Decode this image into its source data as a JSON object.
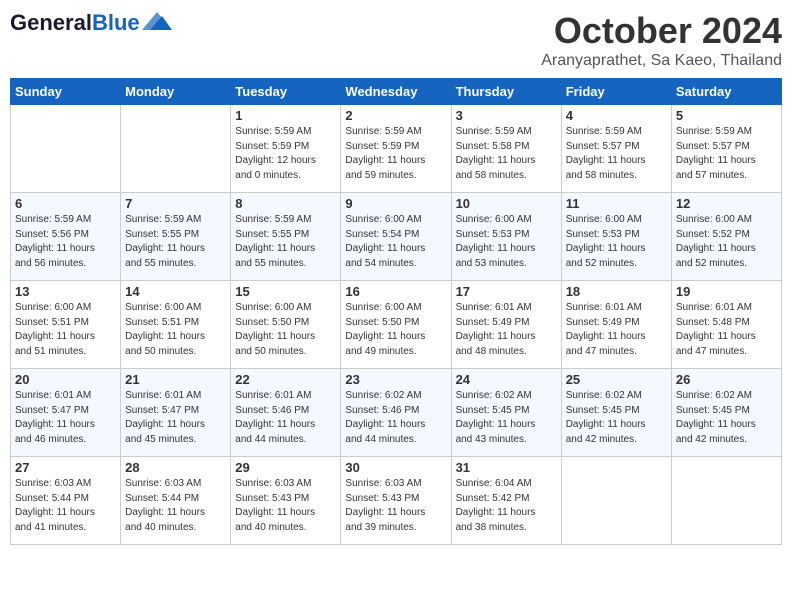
{
  "header": {
    "logo_general": "General",
    "logo_blue": "Blue",
    "month_title": "October 2024",
    "location": "Aranyaprathet, Sa Kaeo, Thailand"
  },
  "days_of_week": [
    "Sunday",
    "Monday",
    "Tuesday",
    "Wednesday",
    "Thursday",
    "Friday",
    "Saturday"
  ],
  "weeks": [
    [
      {
        "day": "",
        "info": ""
      },
      {
        "day": "",
        "info": ""
      },
      {
        "day": "1",
        "info": "Sunrise: 5:59 AM\nSunset: 5:59 PM\nDaylight: 12 hours\nand 0 minutes."
      },
      {
        "day": "2",
        "info": "Sunrise: 5:59 AM\nSunset: 5:59 PM\nDaylight: 11 hours\nand 59 minutes."
      },
      {
        "day": "3",
        "info": "Sunrise: 5:59 AM\nSunset: 5:58 PM\nDaylight: 11 hours\nand 58 minutes."
      },
      {
        "day": "4",
        "info": "Sunrise: 5:59 AM\nSunset: 5:57 PM\nDaylight: 11 hours\nand 58 minutes."
      },
      {
        "day": "5",
        "info": "Sunrise: 5:59 AM\nSunset: 5:57 PM\nDaylight: 11 hours\nand 57 minutes."
      }
    ],
    [
      {
        "day": "6",
        "info": "Sunrise: 5:59 AM\nSunset: 5:56 PM\nDaylight: 11 hours\nand 56 minutes."
      },
      {
        "day": "7",
        "info": "Sunrise: 5:59 AM\nSunset: 5:55 PM\nDaylight: 11 hours\nand 55 minutes."
      },
      {
        "day": "8",
        "info": "Sunrise: 5:59 AM\nSunset: 5:55 PM\nDaylight: 11 hours\nand 55 minutes."
      },
      {
        "day": "9",
        "info": "Sunrise: 6:00 AM\nSunset: 5:54 PM\nDaylight: 11 hours\nand 54 minutes."
      },
      {
        "day": "10",
        "info": "Sunrise: 6:00 AM\nSunset: 5:53 PM\nDaylight: 11 hours\nand 53 minutes."
      },
      {
        "day": "11",
        "info": "Sunrise: 6:00 AM\nSunset: 5:53 PM\nDaylight: 11 hours\nand 52 minutes."
      },
      {
        "day": "12",
        "info": "Sunrise: 6:00 AM\nSunset: 5:52 PM\nDaylight: 11 hours\nand 52 minutes."
      }
    ],
    [
      {
        "day": "13",
        "info": "Sunrise: 6:00 AM\nSunset: 5:51 PM\nDaylight: 11 hours\nand 51 minutes."
      },
      {
        "day": "14",
        "info": "Sunrise: 6:00 AM\nSunset: 5:51 PM\nDaylight: 11 hours\nand 50 minutes."
      },
      {
        "day": "15",
        "info": "Sunrise: 6:00 AM\nSunset: 5:50 PM\nDaylight: 11 hours\nand 50 minutes."
      },
      {
        "day": "16",
        "info": "Sunrise: 6:00 AM\nSunset: 5:50 PM\nDaylight: 11 hours\nand 49 minutes."
      },
      {
        "day": "17",
        "info": "Sunrise: 6:01 AM\nSunset: 5:49 PM\nDaylight: 11 hours\nand 48 minutes."
      },
      {
        "day": "18",
        "info": "Sunrise: 6:01 AM\nSunset: 5:49 PM\nDaylight: 11 hours\nand 47 minutes."
      },
      {
        "day": "19",
        "info": "Sunrise: 6:01 AM\nSunset: 5:48 PM\nDaylight: 11 hours\nand 47 minutes."
      }
    ],
    [
      {
        "day": "20",
        "info": "Sunrise: 6:01 AM\nSunset: 5:47 PM\nDaylight: 11 hours\nand 46 minutes."
      },
      {
        "day": "21",
        "info": "Sunrise: 6:01 AM\nSunset: 5:47 PM\nDaylight: 11 hours\nand 45 minutes."
      },
      {
        "day": "22",
        "info": "Sunrise: 6:01 AM\nSunset: 5:46 PM\nDaylight: 11 hours\nand 44 minutes."
      },
      {
        "day": "23",
        "info": "Sunrise: 6:02 AM\nSunset: 5:46 PM\nDaylight: 11 hours\nand 44 minutes."
      },
      {
        "day": "24",
        "info": "Sunrise: 6:02 AM\nSunset: 5:45 PM\nDaylight: 11 hours\nand 43 minutes."
      },
      {
        "day": "25",
        "info": "Sunrise: 6:02 AM\nSunset: 5:45 PM\nDaylight: 11 hours\nand 42 minutes."
      },
      {
        "day": "26",
        "info": "Sunrise: 6:02 AM\nSunset: 5:45 PM\nDaylight: 11 hours\nand 42 minutes."
      }
    ],
    [
      {
        "day": "27",
        "info": "Sunrise: 6:03 AM\nSunset: 5:44 PM\nDaylight: 11 hours\nand 41 minutes."
      },
      {
        "day": "28",
        "info": "Sunrise: 6:03 AM\nSunset: 5:44 PM\nDaylight: 11 hours\nand 40 minutes."
      },
      {
        "day": "29",
        "info": "Sunrise: 6:03 AM\nSunset: 5:43 PM\nDaylight: 11 hours\nand 40 minutes."
      },
      {
        "day": "30",
        "info": "Sunrise: 6:03 AM\nSunset: 5:43 PM\nDaylight: 11 hours\nand 39 minutes."
      },
      {
        "day": "31",
        "info": "Sunrise: 6:04 AM\nSunset: 5:42 PM\nDaylight: 11 hours\nand 38 minutes."
      },
      {
        "day": "",
        "info": ""
      },
      {
        "day": "",
        "info": ""
      }
    ]
  ]
}
